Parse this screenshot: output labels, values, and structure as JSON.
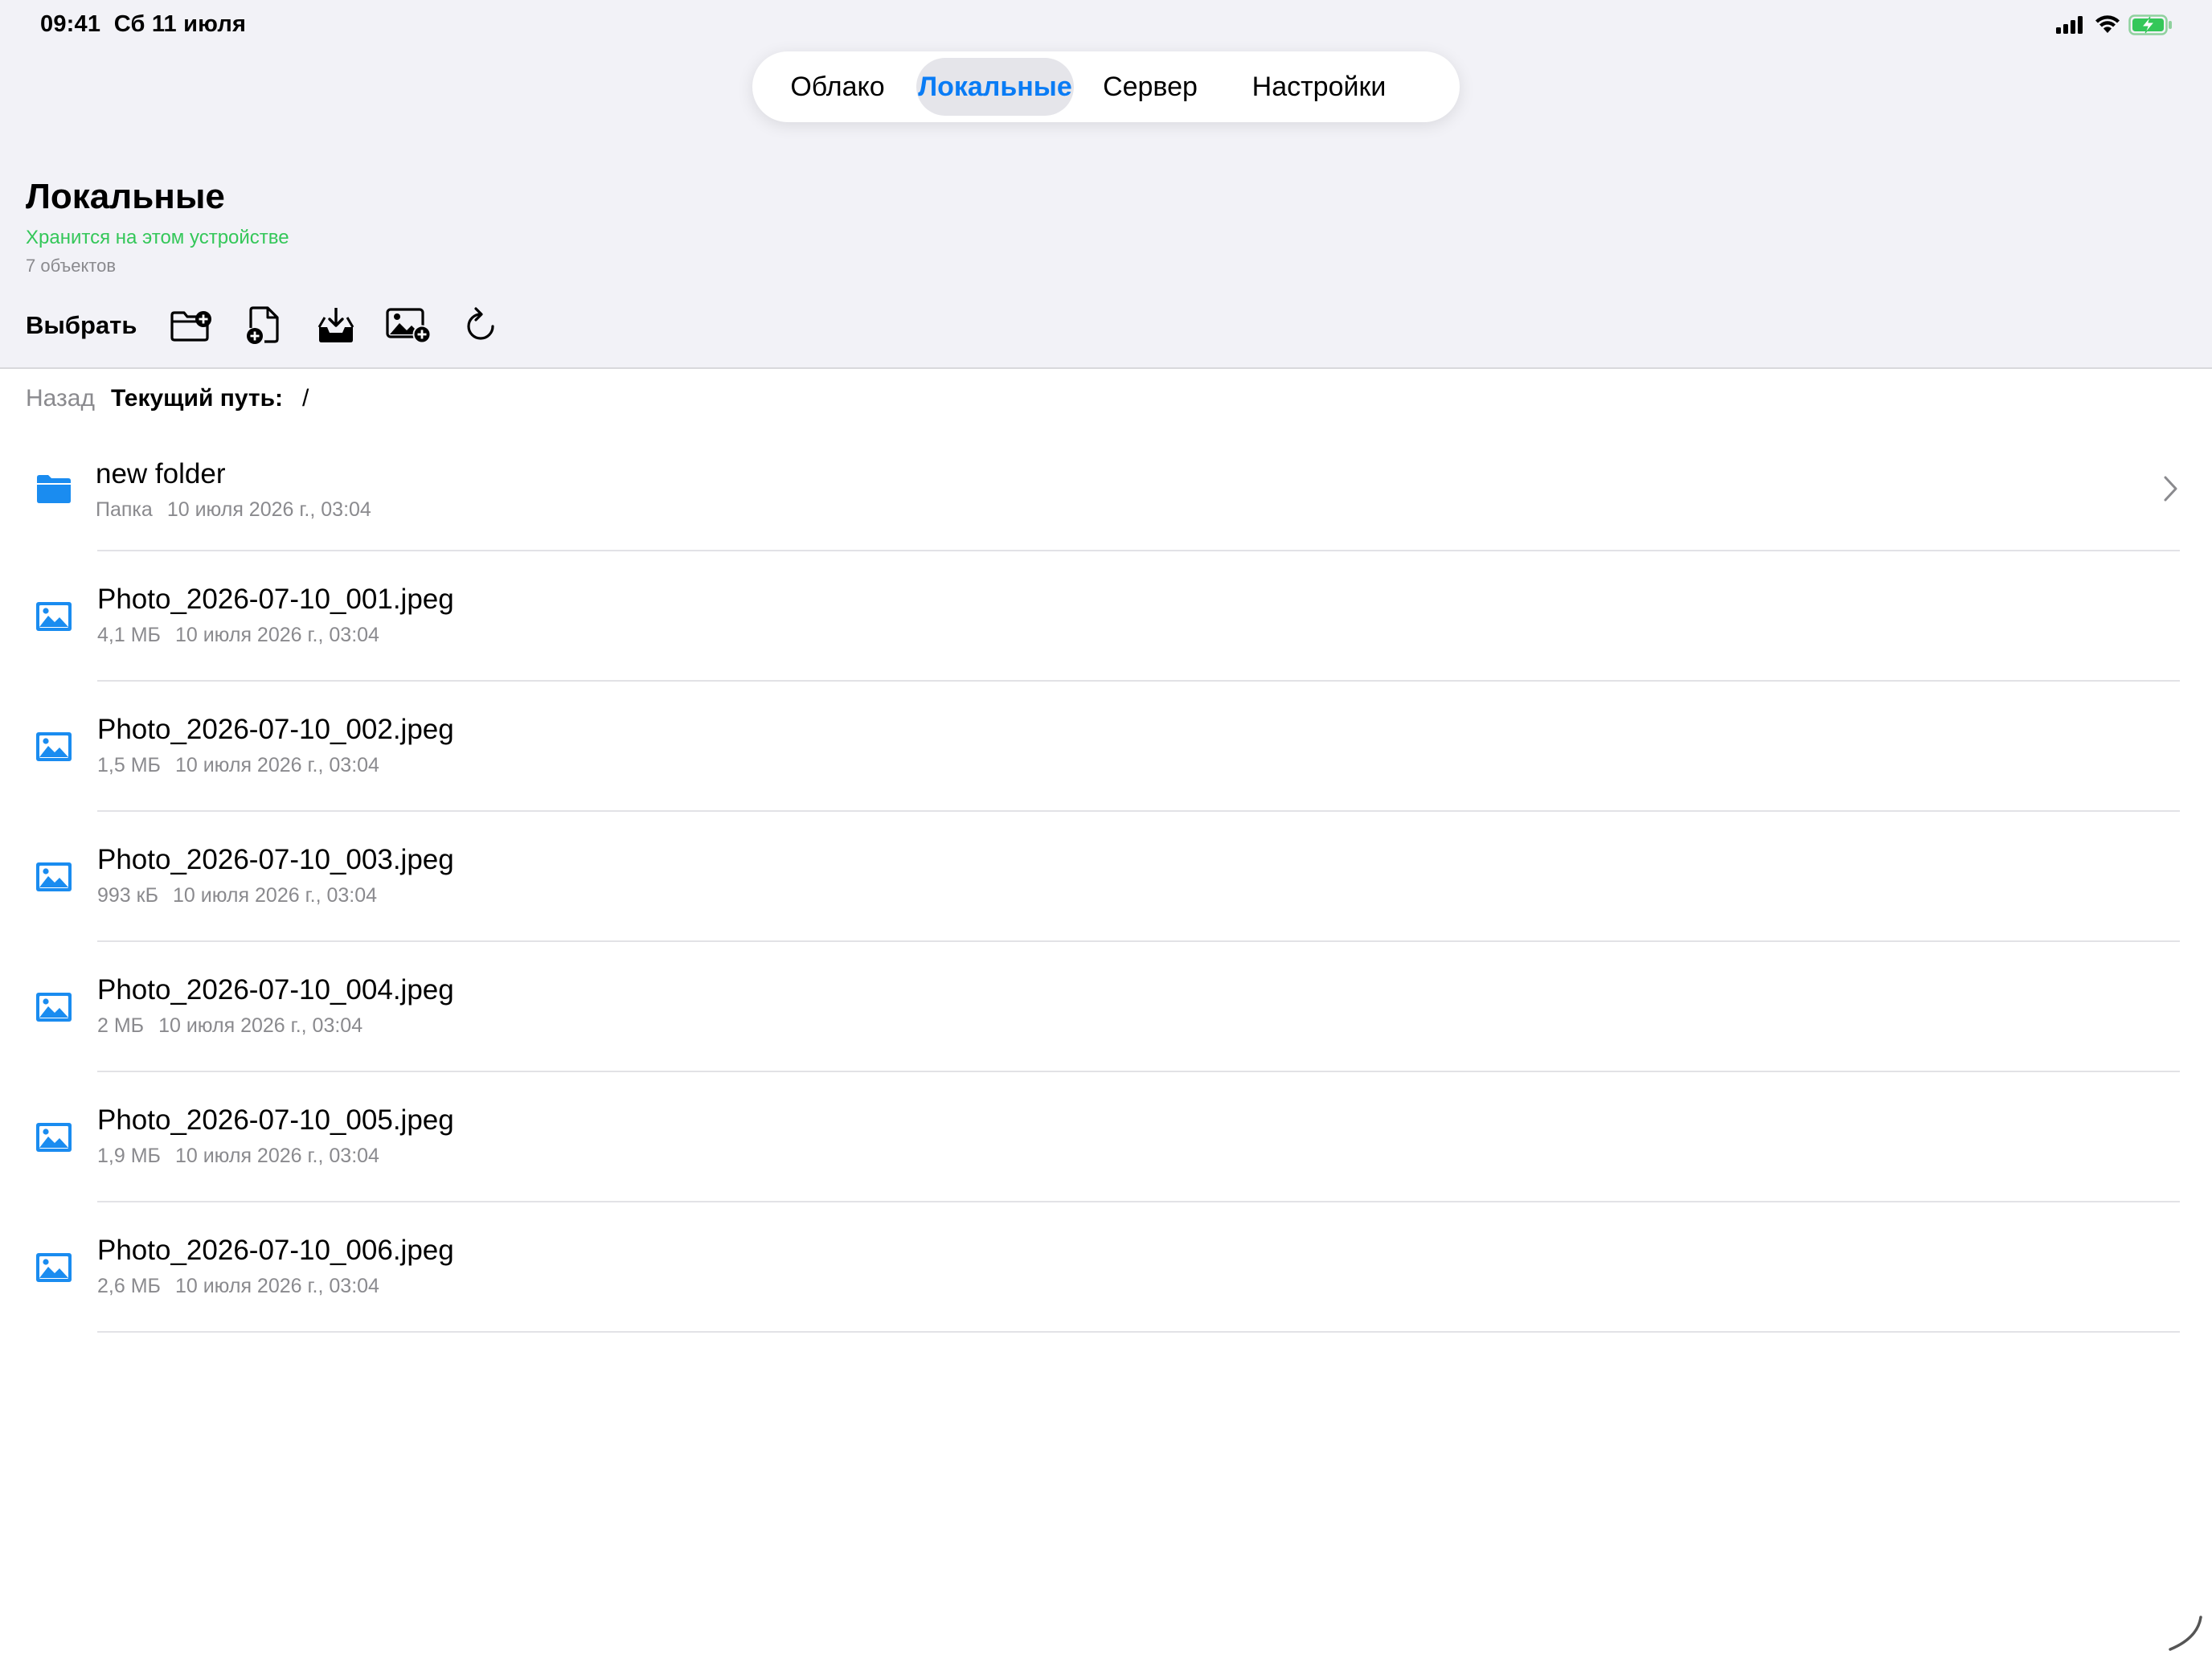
{
  "status": {
    "time": "09:41",
    "date": "Сб 11 июля",
    "icons": [
      "signal-icon",
      "wifi-icon",
      "battery-charging-icon"
    ]
  },
  "tabs": [
    {
      "label": "Облако",
      "active": false
    },
    {
      "label": "Локальные",
      "active": true
    },
    {
      "label": "Сервер",
      "active": false
    },
    {
      "label": "Настройки",
      "active": false
    }
  ],
  "header": {
    "title": "Локальные",
    "subtitle": "Хранится на этом устройстве",
    "count": "7 объектов"
  },
  "toolbar": {
    "select_label": "Выбрать",
    "icons": [
      "new-folder-icon",
      "new-file-icon",
      "import-icon",
      "add-photo-icon",
      "refresh-icon"
    ]
  },
  "breadcrumb": {
    "back_label": "Назад",
    "path_label": "Текущий путь:",
    "path_value": "/"
  },
  "items": [
    {
      "type": "folder",
      "name": "new folder",
      "kind": "Папка",
      "date": "10 июля 2026 г., 03:04"
    },
    {
      "type": "image",
      "name": "Photo_2026-07-10_001.jpeg",
      "size": "4,1 МБ",
      "date": "10 июля 2026 г., 03:04"
    },
    {
      "type": "image",
      "name": "Photo_2026-07-10_002.jpeg",
      "size": "1,5 МБ",
      "date": "10 июля 2026 г., 03:04"
    },
    {
      "type": "image",
      "name": "Photo_2026-07-10_003.jpeg",
      "size": "993 кБ",
      "date": "10 июля 2026 г., 03:04"
    },
    {
      "type": "image",
      "name": "Photo_2026-07-10_004.jpeg",
      "size": "2 МБ",
      "date": "10 июля 2026 г., 03:04"
    },
    {
      "type": "image",
      "name": "Photo_2026-07-10_005.jpeg",
      "size": "1,9 МБ",
      "date": "10 июля 2026 г., 03:04"
    },
    {
      "type": "image",
      "name": "Photo_2026-07-10_006.jpeg",
      "size": "2,6 МБ",
      "date": "10 июля 2026 г., 03:04"
    }
  ],
  "colors": {
    "accent": "#0a7cf5",
    "subtitle_green": "#34c759",
    "secondary_text": "#8a8a8e",
    "header_bg": "#f2f2f7"
  }
}
